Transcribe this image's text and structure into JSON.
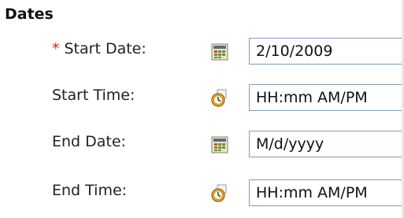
{
  "section": {
    "title": "Dates"
  },
  "fields": [
    {
      "required_mark": "*",
      "label": "Start Date:",
      "icon": "calendar-icon",
      "value": "2/10/2009"
    },
    {
      "label": "Start Time:",
      "icon": "clock-icon",
      "value": "HH:mm AM/PM"
    },
    {
      "label": "End Date:",
      "icon": "calendar-icon",
      "value": "M/d/yyyy"
    },
    {
      "label": "End Time:",
      "icon": "clock-icon",
      "value": "HH:mm AM/PM"
    }
  ],
  "colors": {
    "required": "#e21b1b",
    "input_border": "#7f9db9",
    "background": "#e6e6e6"
  }
}
